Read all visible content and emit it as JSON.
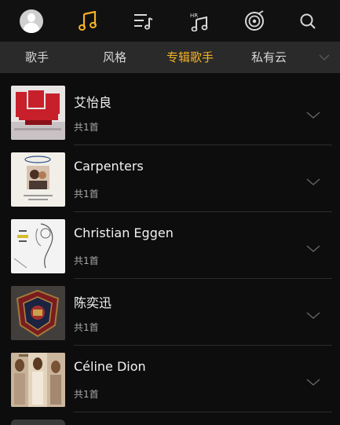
{
  "colors": {
    "accent": "#f5b225",
    "background": "#0d0d0d",
    "tab_bar": "#2a2a2a"
  },
  "topbar": {
    "icons": [
      "avatar",
      "music-note-icon",
      "playlist-icon",
      "hires-music-icon",
      "radio-icon",
      "search-icon"
    ]
  },
  "tabs": [
    {
      "label": "歌手"
    },
    {
      "label": "风格"
    },
    {
      "label": "专辑歌手",
      "active": true
    },
    {
      "label": "私有云"
    }
  ],
  "artists": [
    {
      "name": "艾怡良",
      "count": "共1首"
    },
    {
      "name": "Carpenters",
      "count": "共1首"
    },
    {
      "name": "Christian Eggen",
      "count": "共1首"
    },
    {
      "name": "陈奕迅",
      "count": "共1首"
    },
    {
      "name": "Céline Dion",
      "count": "共1首"
    }
  ]
}
